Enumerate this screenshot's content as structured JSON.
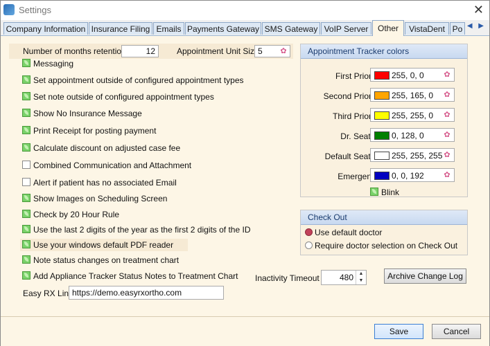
{
  "window": {
    "title": "Settings",
    "close_label": "✕"
  },
  "tabs": [
    {
      "label": "Company Information"
    },
    {
      "label": "Insurance Filing"
    },
    {
      "label": "Emails"
    },
    {
      "label": "Payments Gateway"
    },
    {
      "label": "SMS Gateway"
    },
    {
      "label": "VoIP Server"
    },
    {
      "label": "Other",
      "active": true
    },
    {
      "label": "VistaDent"
    },
    {
      "label": "Po"
    }
  ],
  "tab_scroll": {
    "left": "◀",
    "right": "▶"
  },
  "months_retention": {
    "label": "Number of months retention",
    "value": "12"
  },
  "appointment_unit": {
    "label": "Appointment Unit Size",
    "value": "5"
  },
  "options": [
    {
      "label": "Messaging",
      "checked": true
    },
    {
      "label": "Set appointment outside of configured appointment types",
      "checked": true
    },
    {
      "label": "Set note outside of configured appointment types",
      "checked": true
    },
    {
      "label": "Show No Insurance Message",
      "checked": true
    },
    {
      "label": "Print Receipt for posting payment",
      "checked": true
    },
    {
      "label": "Calculate discount on adjusted case fee",
      "checked": true
    },
    {
      "label": "Combined Communication and Attachment",
      "checked": false
    },
    {
      "label": "Alert if patient has no associated Email",
      "checked": false
    },
    {
      "label": "Show Images on Scheduling Screen",
      "checked": true
    },
    {
      "label": "Check by 20 Hour Rule",
      "checked": true
    },
    {
      "label": "Use the last 2 digits of the year as the first 2 digits of the ID",
      "checked": true
    },
    {
      "label": "Use your windows default PDF reader",
      "checked": true
    },
    {
      "label": "Note status changes on treatment chart",
      "checked": true
    },
    {
      "label": "Add Appliance Tracker Status Notes to Treatment Chart",
      "checked": true
    }
  ],
  "easy_rx": {
    "label": "Easy RX Link",
    "value": "https://demo.easyrxortho.com"
  },
  "tracker_colors": {
    "title": "Appointment Tracker colors",
    "items": [
      {
        "label": "First Priority",
        "value": "255, 0, 0",
        "color": "#ff0000"
      },
      {
        "label": "Second Priority",
        "value": "255, 165, 0",
        "color": "#ffa500"
      },
      {
        "label": "Third Priority",
        "value": "255, 255, 0",
        "color": "#ffff00"
      },
      {
        "label": "Dr. Seated",
        "value": "0, 128, 0",
        "color": "#008000"
      },
      {
        "label": "Default Seated",
        "value": "255, 255, 255",
        "color": "#ffffff"
      },
      {
        "label": "Emergency",
        "value": "0, 0, 192",
        "color": "#0000c0"
      }
    ],
    "blink": {
      "label": "Blink",
      "checked": true
    }
  },
  "check_out": {
    "title": "Check Out",
    "options": [
      {
        "label": "Use default doctor",
        "selected": true
      },
      {
        "label": "Require doctor selection on Check Out",
        "selected": false
      }
    ]
  },
  "inactivity": {
    "label": "Inactivity Timeout",
    "value": "480",
    "up": "▲",
    "down": "▼"
  },
  "buttons": {
    "archive": "Archive Change Log",
    "save": "Save",
    "cancel": "Cancel"
  }
}
